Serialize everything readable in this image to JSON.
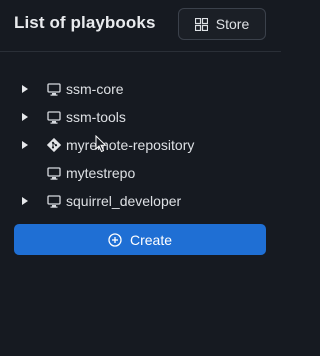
{
  "header": {
    "title": "List of playbooks",
    "store_label": "Store"
  },
  "tree": {
    "items": [
      {
        "label": "ssm-core",
        "icon": "desktop-icon",
        "expandable": true
      },
      {
        "label": "ssm-tools",
        "icon": "desktop-icon",
        "expandable": true
      },
      {
        "label": "myremote-repository",
        "icon": "git-icon",
        "expandable": true
      },
      {
        "label": "mytestrepo",
        "icon": "desktop-icon",
        "expandable": false
      },
      {
        "label": "squirrel_developer",
        "icon": "desktop-icon",
        "expandable": true
      }
    ]
  },
  "actions": {
    "create_label": "Create"
  },
  "colors": {
    "background": "#161a21",
    "accent": "#1f6fd4",
    "text": "#dde0e4"
  }
}
